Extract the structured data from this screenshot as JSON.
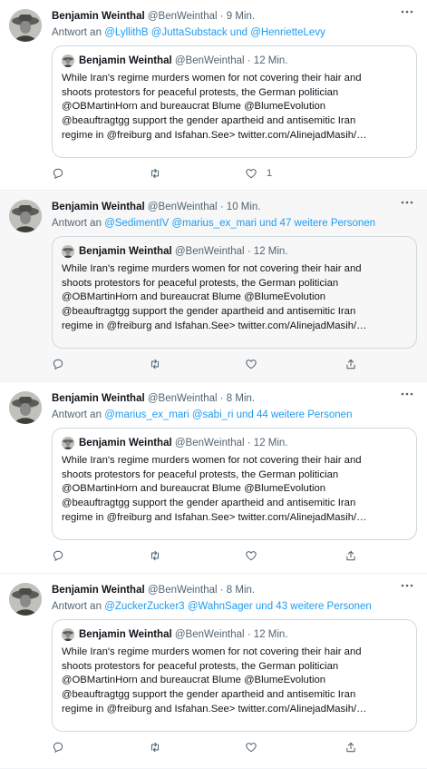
{
  "tweets": [
    {
      "author_name": "Benjamin Weinthal",
      "author_handle": "@BenWeinthal",
      "separator": "·",
      "time": "9 Min.",
      "reply_prefix": "Antwort an",
      "reply_targets": "@LyllithB @JuttaSubstack und @HenrietteLevy",
      "quote": {
        "author_name": "Benjamin Weinthal",
        "author_handle": "@BenWeinthal",
        "separator": "·",
        "time": "12 Min.",
        "text": "While Iran's regime murders women for not covering their hair and\nshoots protestors for peaceful protests, the German politician\n@OBMartinHorn and bureaucrat Blume @BlumeEvolution\n@beauftragtgg support the gender apartheid and antisemitic Iran\nregime in @freiburg and Isfahan.See> twitter.com/AlinejadMasih/…"
      },
      "like_count": "1"
    },
    {
      "author_name": "Benjamin Weinthal",
      "author_handle": "@BenWeinthal",
      "separator": "·",
      "time": "10 Min.",
      "reply_prefix": "Antwort an",
      "reply_targets": "@SedimentIV @marius_ex_mari und 47 weitere Personen",
      "quote": {
        "author_name": "Benjamin Weinthal",
        "author_handle": "@BenWeinthal",
        "separator": "·",
        "time": "12 Min.",
        "text": "While Iran's regime murders women for not covering their hair and\nshoots protestors for peaceful protests, the German politician\n@OBMartinHorn and bureaucrat Blume @BlumeEvolution\n@beauftragtgg support the gender apartheid and antisemitic Iran\nregime in @freiburg and Isfahan.See> twitter.com/AlinejadMasih/…"
      },
      "like_count": ""
    },
    {
      "author_name": "Benjamin Weinthal",
      "author_handle": "@BenWeinthal",
      "separator": "·",
      "time": "8 Min.",
      "reply_prefix": "Antwort an",
      "reply_targets": "@marius_ex_mari @sabi_ri und 44 weitere Personen",
      "quote": {
        "author_name": "Benjamin Weinthal",
        "author_handle": "@BenWeinthal",
        "separator": "·",
        "time": "12 Min.",
        "text": "While Iran's regime murders women for not covering their hair and\nshoots protestors for peaceful protests, the German politician\n@OBMartinHorn and bureaucrat Blume @BlumeEvolution\n@beauftragtgg support the gender apartheid and antisemitic Iran\nregime in @freiburg and Isfahan.See> twitter.com/AlinejadMasih/…"
      },
      "like_count": ""
    },
    {
      "author_name": "Benjamin Weinthal",
      "author_handle": "@BenWeinthal",
      "separator": "·",
      "time": "8 Min.",
      "reply_prefix": "Antwort an",
      "reply_targets": "@ZuckerZucker3 @WahnSager und 43 weitere Personen",
      "quote": {
        "author_name": "Benjamin Weinthal",
        "author_handle": "@BenWeinthal",
        "separator": "·",
        "time": "12 Min.",
        "text": "While Iran's regime murders women for not covering their hair and\nshoots protestors for peaceful protests, the German politician\n@OBMartinHorn and bureaucrat Blume @BlumeEvolution\n@beauftragtgg support the gender apartheid and antisemitic Iran\nregime in @freiburg and Isfahan.See> twitter.com/AlinejadMasih/…"
      },
      "like_count": ""
    }
  ],
  "icons": {
    "reply": "reply-icon",
    "retweet": "retweet-icon",
    "like": "heart-icon",
    "share": "share-icon",
    "more": "more-icon"
  },
  "colors": {
    "link": "#1d9bf0",
    "secondary_text": "#536471",
    "border": "#cfd9de",
    "hover_background": "#f7f7f7"
  }
}
